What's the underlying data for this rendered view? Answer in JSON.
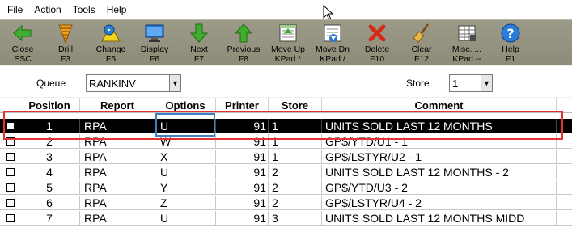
{
  "menu": [
    "File",
    "Action",
    "Tools",
    "Help"
  ],
  "toolbar": [
    {
      "name": "close",
      "label1": "Close",
      "label2": "ESC"
    },
    {
      "name": "drill",
      "label1": "Drill",
      "label2": "F3"
    },
    {
      "name": "change",
      "label1": "Change",
      "label2": "F5"
    },
    {
      "name": "display",
      "label1": "Display",
      "label2": "F6"
    },
    {
      "name": "next",
      "label1": "Next",
      "label2": "F7"
    },
    {
      "name": "previous",
      "label1": "Previous",
      "label2": "F8"
    },
    {
      "name": "move-up",
      "label1": "Move Up",
      "label2": "KPad *"
    },
    {
      "name": "move-down",
      "label1": "Move Dn",
      "label2": "KPad /"
    },
    {
      "name": "delete",
      "label1": "Delete",
      "label2": "F10"
    },
    {
      "name": "clear",
      "label1": "Clear",
      "label2": "F12"
    },
    {
      "name": "misc",
      "label1": "Misc. ...",
      "label2": "KPad --"
    },
    {
      "name": "help",
      "label1": "Help",
      "label2": "F1"
    }
  ],
  "filters": {
    "queue_label": "Queue",
    "queue_value": "RANKINV",
    "store_label": "Store",
    "store_value": "1"
  },
  "table": {
    "columns": [
      "Position",
      "Report",
      "Options",
      "Printer",
      "Store",
      "Comment"
    ],
    "selected_row": 0,
    "rows": [
      {
        "position": "1",
        "report": "RPA",
        "options": "U",
        "printer": "91",
        "store": "1",
        "comment": "UNITS SOLD LAST 12 MONTHS"
      },
      {
        "position": "2",
        "report": "RPA",
        "options": "W",
        "printer": "91",
        "store": "1",
        "comment": "GP$/YTD/U1 - 1"
      },
      {
        "position": "3",
        "report": "RPA",
        "options": "X",
        "printer": "91",
        "store": "1",
        "comment": "GP$/LSTYR/U2 - 1"
      },
      {
        "position": "4",
        "report": "RPA",
        "options": "U",
        "printer": "91",
        "store": "2",
        "comment": "UNITS SOLD LAST 12 MONTHS - 2"
      },
      {
        "position": "5",
        "report": "RPA",
        "options": "Y",
        "printer": "91",
        "store": "2",
        "comment": "GP$/YTD/U3 - 2"
      },
      {
        "position": "6",
        "report": "RPA",
        "options": "Z",
        "printer": "91",
        "store": "2",
        "comment": "GP$/LSTYR/U4 - 2"
      },
      {
        "position": "7",
        "report": "RPA",
        "options": "U",
        "printer": "91",
        "store": "3",
        "comment": "UNITS SOLD LAST 12 MONTHS MIDD"
      }
    ]
  },
  "colors": {
    "selection": "#000000",
    "highlight_box": "#e23232",
    "focus_box": "#3f7fc5",
    "toolbar": "#969482"
  }
}
